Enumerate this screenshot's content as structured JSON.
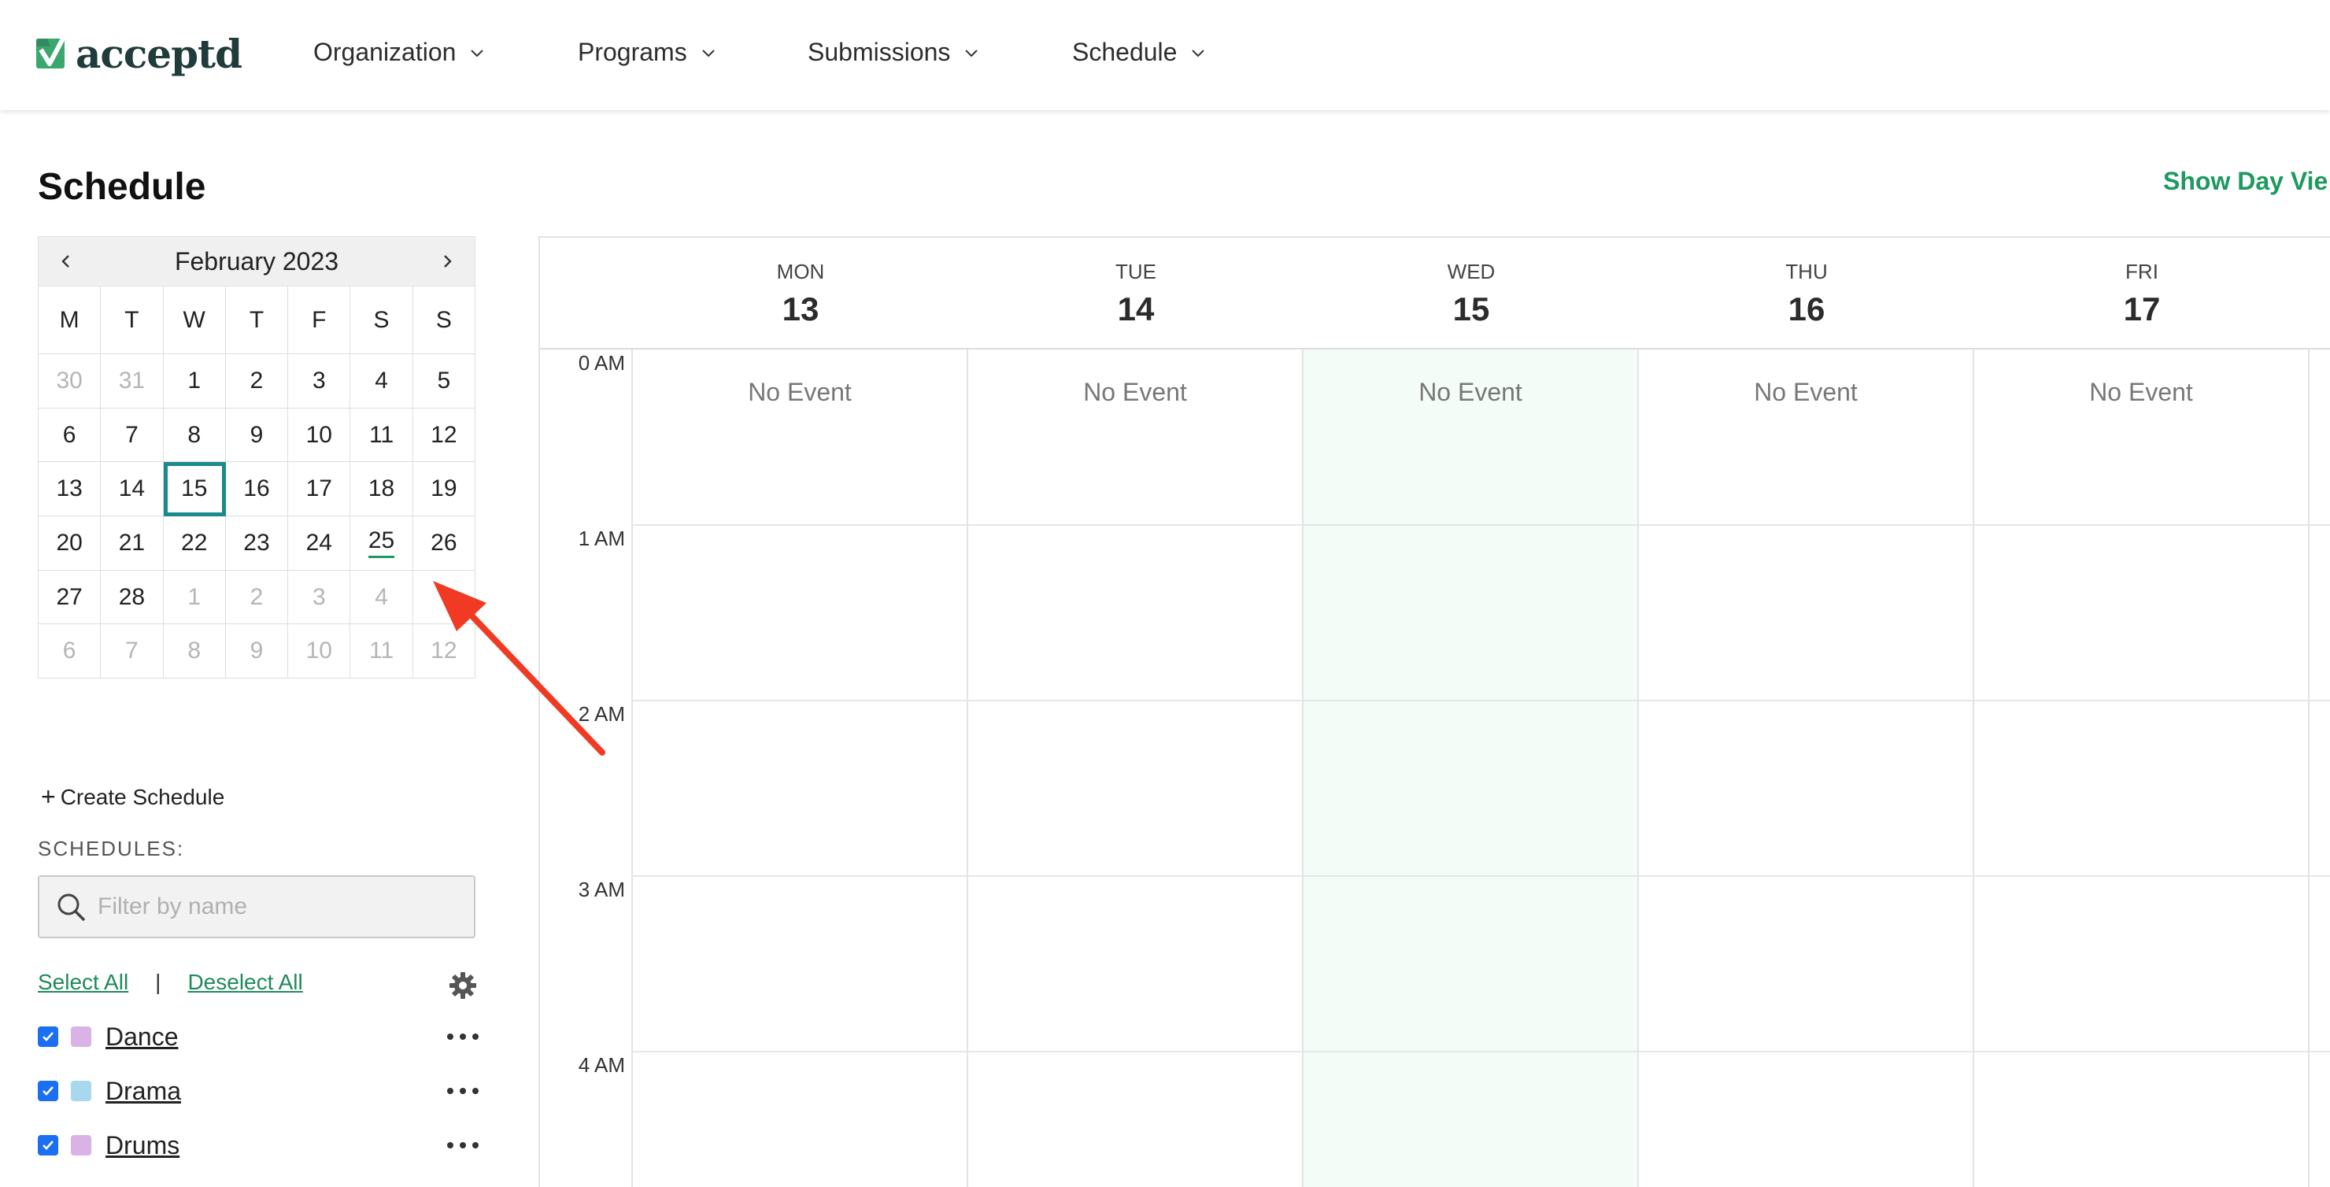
{
  "nav": {
    "logo_text": "acceptd",
    "items": [
      {
        "label": "Organization"
      },
      {
        "label": "Programs"
      },
      {
        "label": "Submissions"
      },
      {
        "label": "Schedule"
      }
    ]
  },
  "page": {
    "title": "Schedule",
    "show_day_view": "Show Day Vie"
  },
  "mini_calendar": {
    "month_label": "February 2023",
    "weekdays": [
      "M",
      "T",
      "W",
      "T",
      "F",
      "S",
      "S"
    ],
    "weeks": [
      [
        "30",
        "31",
        "1",
        "2",
        "3",
        "4",
        "5"
      ],
      [
        "6",
        "7",
        "8",
        "9",
        "10",
        "11",
        "12"
      ],
      [
        "13",
        "14",
        "15",
        "16",
        "17",
        "18",
        "19"
      ],
      [
        "20",
        "21",
        "22",
        "23",
        "24",
        "25",
        "26"
      ],
      [
        "27",
        "28",
        "1",
        "2",
        "3",
        "4",
        ""
      ],
      [
        "6",
        "7",
        "8",
        "9",
        "10",
        "11",
        "12"
      ]
    ],
    "selected_day": "15",
    "marked_day": "25"
  },
  "sidebar": {
    "create_label": "Create Schedule",
    "schedules_heading": "SCHEDULES:",
    "filter_placeholder": "Filter by name",
    "select_all": "Select All",
    "separator": "|",
    "deselect_all": "Deselect All",
    "schedules": [
      {
        "name": "Dance",
        "checked": true,
        "color": "#d9b3e6"
      },
      {
        "name": "Drama",
        "checked": true,
        "color": "#a8d8ee"
      },
      {
        "name": "Drums",
        "checked": true,
        "color": "#d9b3e6"
      }
    ]
  },
  "week": {
    "days": [
      {
        "dow": "MON",
        "num": "13",
        "event_text": "No Event"
      },
      {
        "dow": "TUE",
        "num": "14",
        "event_text": "No Event"
      },
      {
        "dow": "WED",
        "num": "15",
        "event_text": "No Event",
        "today": true
      },
      {
        "dow": "THU",
        "num": "16",
        "event_text": "No Event"
      },
      {
        "dow": "FRI",
        "num": "17",
        "event_text": "No Event"
      }
    ],
    "hours": [
      "0 AM",
      "1 AM",
      "2 AM",
      "3 AM",
      "4 AM"
    ]
  },
  "colors": {
    "accent_green": "#1e9960",
    "today_outline": "#1a8a8f",
    "today_column_bg": "#f3fcf7",
    "annotation_arrow": "#f03a24"
  }
}
